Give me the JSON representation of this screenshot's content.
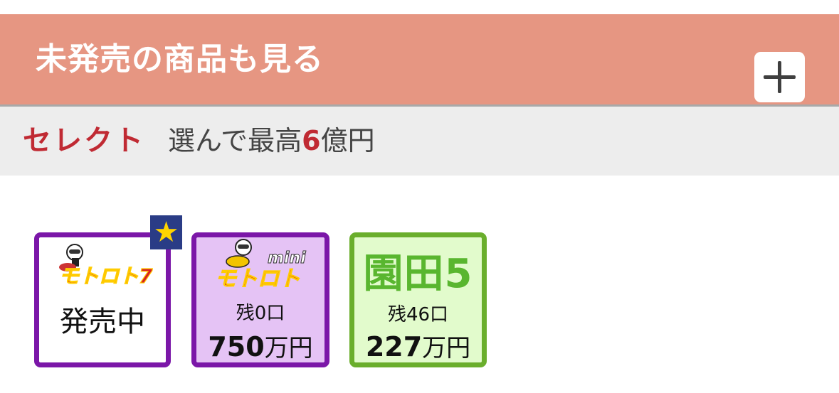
{
  "unreleased": {
    "title": "未発売の商品も見る",
    "expand_icon": "plus-icon"
  },
  "select": {
    "label": "セレクト",
    "desc_prefix": "選んで最高",
    "desc_amount": "6",
    "desc_suffix": "億円"
  },
  "products": [
    {
      "logo_text": "モトロト7",
      "status": "発売中",
      "badge_icon": "star-icon"
    },
    {
      "logo_text_small": "mini",
      "logo_text": "モトロト",
      "remaining": "残0口",
      "prize_num": "750",
      "prize_unit": "万円"
    },
    {
      "name": "園田5",
      "remaining": "残46口",
      "prize_num": "227",
      "prize_unit": "万円"
    }
  ],
  "colors": {
    "header_bg": "#e69682",
    "select_bg": "#ededed",
    "accent_red": "#c02a33",
    "purple_border": "#7b17a8",
    "mini_bg": "#e5c3f5",
    "green_border": "#6aae2c",
    "green_bg": "#e2fbcc",
    "green_text": "#59b62f",
    "badge_bg": "#2a3c86",
    "badge_star": "#ffd400"
  }
}
